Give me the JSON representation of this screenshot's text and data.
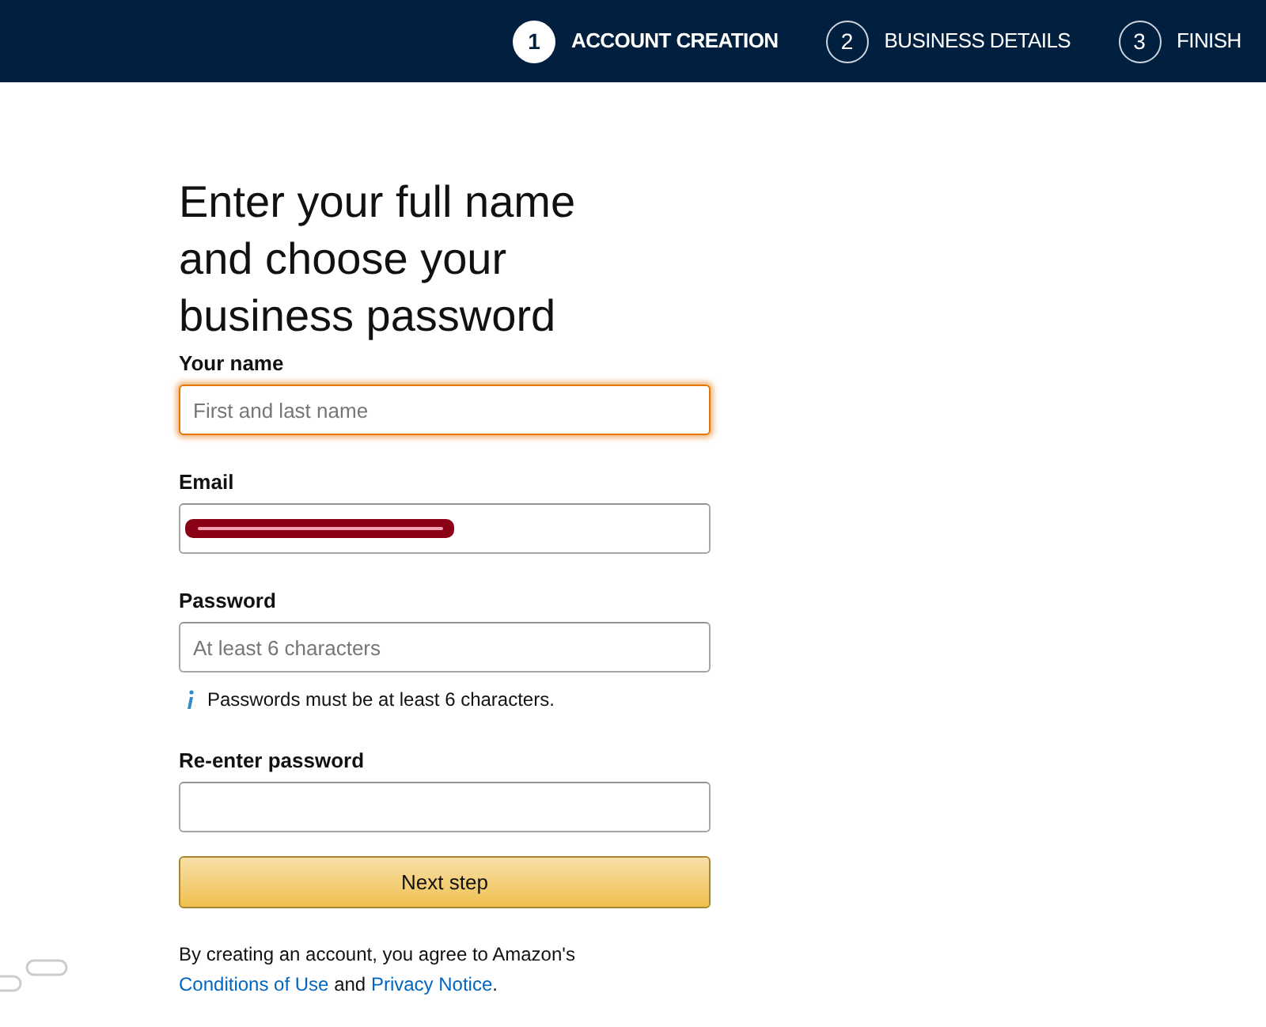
{
  "steps": [
    {
      "number": "1",
      "label": "ACCOUNT CREATION",
      "selected": true
    },
    {
      "number": "2",
      "label": "BUSINESS DETAILS",
      "selected": false
    },
    {
      "number": "3",
      "label": "FINISH",
      "selected": false
    }
  ],
  "title": "Enter your full name and choose your business password",
  "fields": [
    {
      "label": "Your name",
      "placeholder": "First and last name",
      "focused": true,
      "redacted": false
    },
    {
      "label": "Email",
      "focused": false,
      "redacted": true
    },
    {
      "label": "Password",
      "placeholder": "At least 6 characters",
      "focused": false,
      "redacted": false,
      "hint": "Passwords must be at least 6 characters."
    },
    {
      "label": "Re-enter password",
      "focused": false,
      "redacted": false
    }
  ],
  "submit_button": "Next step",
  "legal": [
    {
      "kind": "text",
      "text": "By creating an account, you agree to Amazon's"
    },
    {
      "kind": "link",
      "text": "Conditions of Use"
    },
    {
      "kind": "text",
      "text": "and"
    },
    {
      "kind": "link",
      "text": "Privacy Notice"
    },
    {
      "kind": "text",
      "text": "."
    }
  ]
}
